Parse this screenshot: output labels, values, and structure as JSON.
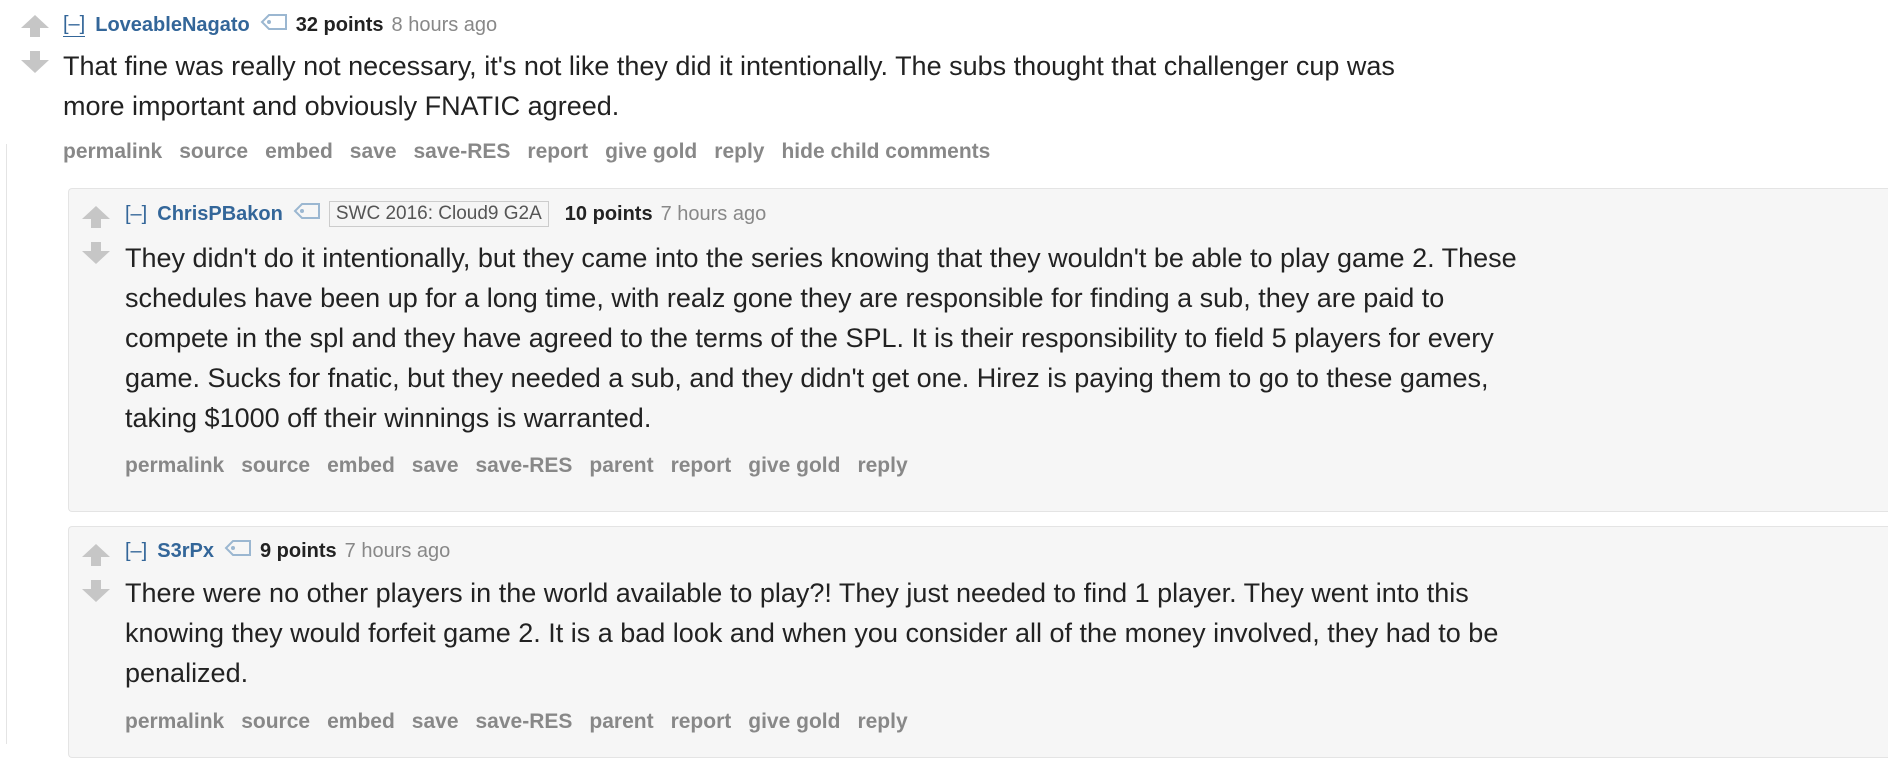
{
  "parent_comment": {
    "expand": "[–]",
    "author": "LoveableNagato",
    "score": "32 points",
    "time": "8 hours ago",
    "body_lines": [
      "That fine was really not necessary, it's not like they did it intentionally. The subs thought that challenger cup was",
      "more important and obviously FNATIC agreed."
    ],
    "actions": [
      "permalink",
      "source",
      "embed",
      "save",
      "save-RES",
      "report",
      "give gold",
      "reply",
      "hide child comments"
    ]
  },
  "replies": [
    {
      "expand": "[–]",
      "author": "ChrisPBakon",
      "flair": "SWC 2016: Cloud9 G2A",
      "score": "10 points",
      "time": "7 hours ago",
      "body_lines": [
        "They didn't do it intentionally, but they came into the series knowing that they wouldn't be able to play game 2. These",
        "schedules have been up for a long time, with realz gone they are responsible for finding a sub, they are paid to",
        "compete in the spl and they have agreed to the terms of the SPL. It is their responsibility to field 5 players for every",
        "game. Sucks for fnatic, but they needed a sub, and they didn't get one. Hirez is paying them to go to these games,",
        "taking $1000 off their winnings is warranted."
      ],
      "actions": [
        "permalink",
        "source",
        "embed",
        "save",
        "save-RES",
        "parent",
        "report",
        "give gold",
        "reply"
      ]
    },
    {
      "expand": "[–]",
      "author": "S3rPx",
      "score": "9 points",
      "time": "7 hours ago",
      "body_lines": [
        "There were no other players in the world available to play?! They just needed to find 1 player. They went into this",
        "knowing they would forfeit game 2. It is a bad look and when you consider all of the money involved, they had to be",
        "penalized."
      ],
      "actions": [
        "permalink",
        "source",
        "embed",
        "save",
        "save-RES",
        "parent",
        "report",
        "give gold",
        "reply"
      ]
    }
  ],
  "icons": {
    "upvote": "arrow-up-icon",
    "downvote": "arrow-down-icon",
    "user_tag": "tag-icon"
  },
  "colors": {
    "author": "#336699",
    "meta": "#888888",
    "arrow": "#c6c6c6",
    "child_bg": "#f6f6f6"
  }
}
